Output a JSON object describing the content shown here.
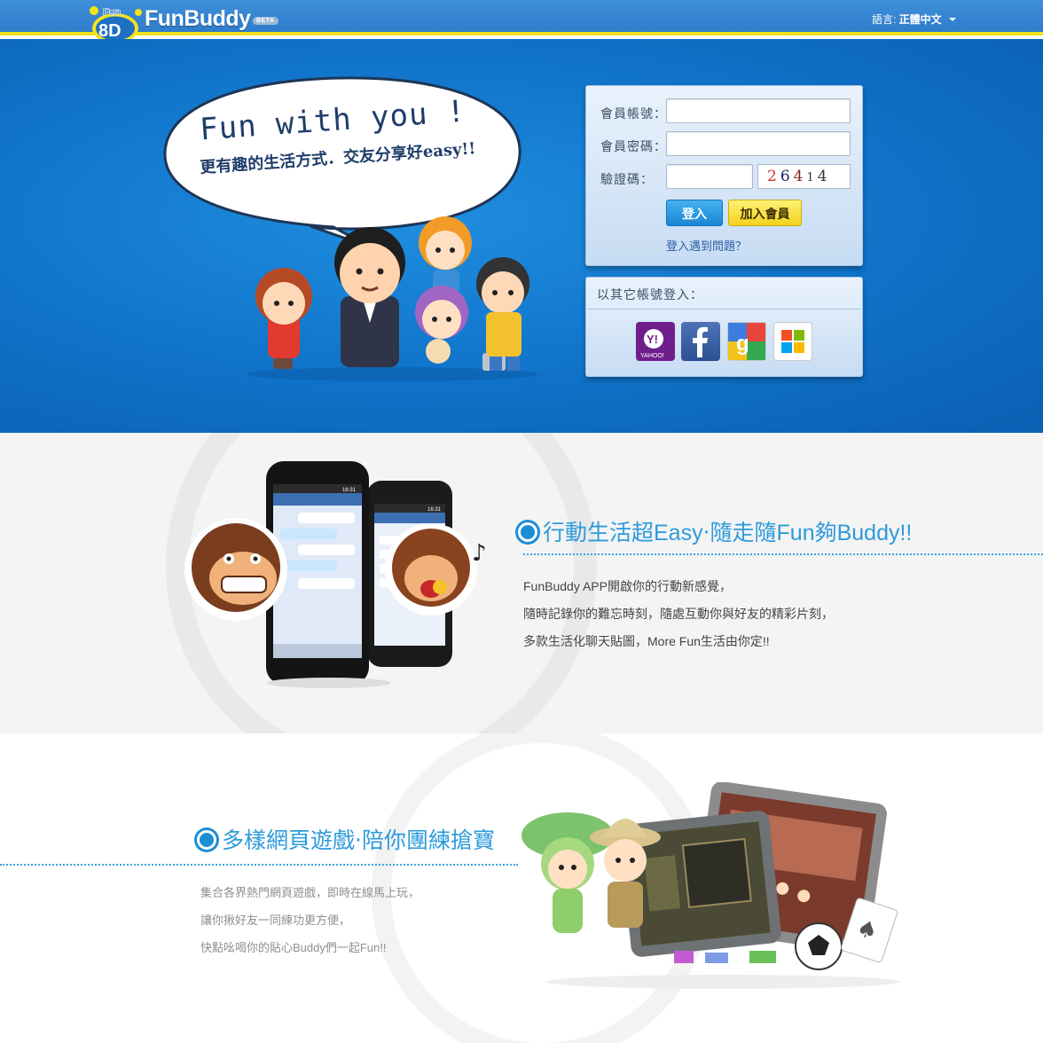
{
  "header": {
    "logo_badge_top": "Fun",
    "logo_badge_bottom": "8D",
    "logo_text": "FunBuddy",
    "beta_label": "BETA",
    "language_label": "語言:",
    "language_value": "正體中文"
  },
  "hero": {
    "bubble_title": "Fun with you !",
    "bubble_subtitle": "更有趣的生活方式．交友分享好easy!!"
  },
  "login": {
    "account_label": "會員帳號：",
    "password_label": "會員密碼：",
    "captcha_label": "驗證碼：",
    "captcha_digits": [
      "2",
      "6",
      "4",
      "1",
      "4"
    ],
    "login_button": "登入",
    "join_button": "加入會員",
    "help_link": "登入遇到問題？"
  },
  "social": {
    "title": "以其它帳號登入：",
    "providers": [
      "yahoo",
      "facebook",
      "google",
      "microsoft"
    ],
    "yahoo_text": "YAHOO!"
  },
  "section_mobile": {
    "title": "行動生活超Easy‧隨走隨Fun夠Buddy!!",
    "lines": [
      "FunBuddy APP開啟你的行動新感覺，",
      "隨時記錄你的難忘時刻，隨處互動你與好友的精彩片刻，",
      "多款生活化聊天貼圖，More Fun生活由你定!!"
    ],
    "phone_time_left": "16:31",
    "phone_time_right": "16:31"
  },
  "section_games": {
    "title": "多樣網頁遊戲‧陪你團練搶寶",
    "lines": [
      "集合各界熱門網頁遊戲，即時在線馬上玩，",
      "讓你揪好友一同練功更方便，",
      "快點吆喝你的貼心Buddy們一起Fun!!"
    ]
  },
  "colors": {
    "header_blue": "#2f7ccb",
    "header_underline": "#f4e21c",
    "hero_blue": "#0f72c8",
    "accent_blue": "#2d9bdb",
    "join_yellow": "#f4d21c"
  }
}
